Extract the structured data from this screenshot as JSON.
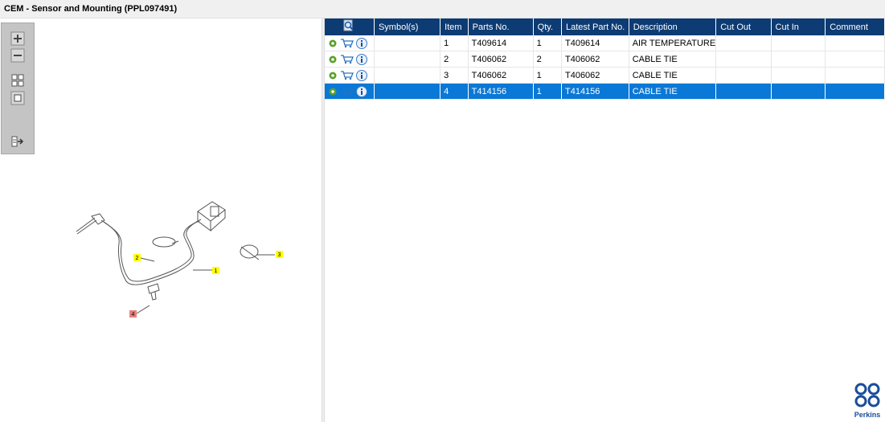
{
  "window": {
    "title": "CEM - Sensor and Mounting (PPL097491)"
  },
  "toolbar": {
    "icons": [
      "zoom-in-icon",
      "zoom-out-icon",
      "fit-icon",
      "actual-size-icon",
      "export-icon"
    ]
  },
  "drawing": {
    "callouts": [
      "1",
      "2",
      "3",
      "4"
    ]
  },
  "table": {
    "columns": [
      "Symbol(s)",
      "Item",
      "Parts No.",
      "Qty.",
      "Latest Part No.",
      "Description",
      "Cut Out",
      "Cut In",
      "Comment"
    ],
    "rows": [
      {
        "symbols": "",
        "item": "1",
        "part_no": "T409614",
        "qty": "1",
        "latest": "T409614",
        "description": "AIR TEMPERATURE",
        "cut_out": "",
        "cut_in": "",
        "comment": ""
      },
      {
        "symbols": "",
        "item": "2",
        "part_no": "T406062",
        "qty": "2",
        "latest": "T406062",
        "description": "CABLE TIE",
        "cut_out": "",
        "cut_in": "",
        "comment": ""
      },
      {
        "symbols": "",
        "item": "3",
        "part_no": "T406062",
        "qty": "1",
        "latest": "T406062",
        "description": "CABLE TIE",
        "cut_out": "",
        "cut_in": "",
        "comment": ""
      },
      {
        "symbols": "",
        "item": "4",
        "part_no": "T414156",
        "qty": "1",
        "latest": "T414156",
        "description": "CABLE TIE",
        "cut_out": "",
        "cut_in": "",
        "comment": ""
      }
    ],
    "selected_row": 3
  },
  "logo": {
    "text": "Perkins"
  },
  "colors": {
    "header": "#0d3b73",
    "selected": "#0a78d6",
    "callout": "#ffff00",
    "callout_selected": "#e77f7f"
  }
}
